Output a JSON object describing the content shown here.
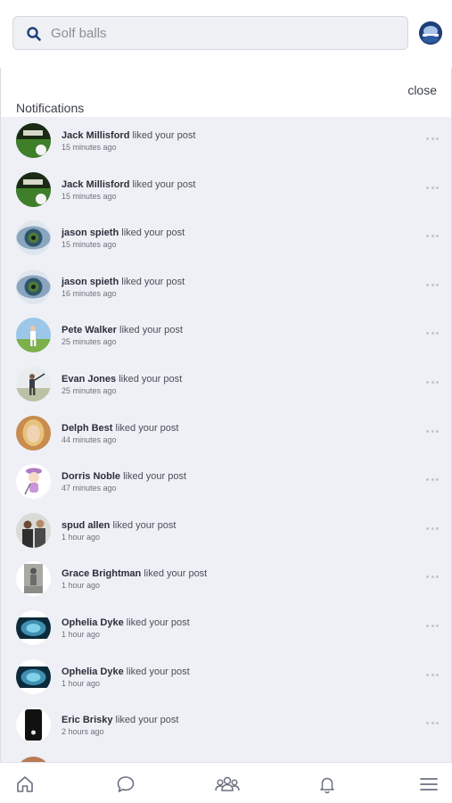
{
  "search": {
    "placeholder": "Golf balls"
  },
  "panel": {
    "close_label": "close",
    "title": "Notifications"
  },
  "notifications": [
    {
      "name": "Jack Millisford",
      "action": "liked your post",
      "time": "15 minutes ago",
      "avatar": "golf-green"
    },
    {
      "name": "Jack Millisford",
      "action": "liked your post",
      "time": "15 minutes ago",
      "avatar": "golf-green"
    },
    {
      "name": "jason spieth",
      "action": "liked your post",
      "time": "15 minutes ago",
      "avatar": "eye"
    },
    {
      "name": "jason spieth",
      "action": "liked your post",
      "time": "16 minutes ago",
      "avatar": "eye"
    },
    {
      "name": "Pete Walker",
      "action": "liked your post",
      "time": "25 minutes ago",
      "avatar": "golfer-course"
    },
    {
      "name": "Evan Jones",
      "action": "liked your post",
      "time": "25 minutes ago",
      "avatar": "golfer-swing"
    },
    {
      "name": "Delph Best",
      "action": "liked your post",
      "time": "44 minutes ago",
      "avatar": "woman-blonde"
    },
    {
      "name": "Dorris Noble",
      "action": "liked your post",
      "time": "47 minutes ago",
      "avatar": "cartoon-golfer"
    },
    {
      "name": "spud allen",
      "action": "liked your post",
      "time": "1 hour ago",
      "avatar": "two-men"
    },
    {
      "name": "Grace Brightman",
      "action": "liked your post",
      "time": "1 hour ago",
      "avatar": "vintage-photo"
    },
    {
      "name": "Ophelia Dyke",
      "action": "liked your post",
      "time": "1 hour ago",
      "avatar": "brain-scan"
    },
    {
      "name": "Ophelia Dyke",
      "action": "liked your post",
      "time": "1 hour ago",
      "avatar": "brain-scan"
    },
    {
      "name": "Eric Brisky",
      "action": "liked your post",
      "time": "2 hours ago",
      "avatar": "phone-dark"
    }
  ],
  "tabbar": {
    "items": [
      {
        "name": "home",
        "icon": "home-icon"
      },
      {
        "name": "messages",
        "icon": "chat-bubble-icon"
      },
      {
        "name": "groups",
        "icon": "people-group-icon"
      },
      {
        "name": "notifications",
        "icon": "bell-icon"
      },
      {
        "name": "menu",
        "icon": "hamburger-menu-icon"
      }
    ]
  },
  "colors": {
    "accent": "#1f3f7a",
    "panel_bg": "#eef0f6",
    "text": "#2b2f3a"
  }
}
